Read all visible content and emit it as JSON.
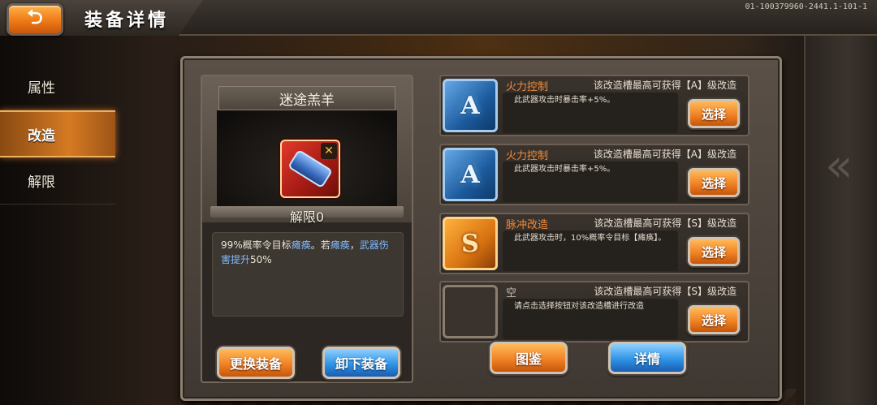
{
  "header": {
    "title": "装备详情",
    "back_icon": "back-arrow-icon",
    "version": "01-100379960-2441.1-101-1"
  },
  "nav": {
    "items": [
      {
        "label": "属性",
        "active": false
      },
      {
        "label": "改造",
        "active": true
      },
      {
        "label": "解限",
        "active": false
      }
    ]
  },
  "equipment": {
    "name": "迷途羔羊",
    "icon": "blue-cannon-weapon-icon",
    "badge_icon": "wrench-icon",
    "limit_label": "解限0",
    "description": {
      "part1": "99%概率令目标",
      "hl1": "瘫痪",
      "part2": "。若",
      "hl2": "瘫痪",
      "part3": "，",
      "hl3": "武器伤害提升",
      "part4": "50%"
    },
    "change_button": "更换装备",
    "unequip_button": "卸下装备"
  },
  "slots": [
    {
      "grade": "A",
      "name": "火力控制",
      "cap": "该改造槽最高可获得【A】级改造",
      "desc": "此武器攻击时暴击率+5%。",
      "button": "选择"
    },
    {
      "grade": "A",
      "name": "火力控制",
      "cap": "该改造槽最高可获得【A】级改造",
      "desc": "此武器攻击时暴击率+5%。",
      "button": "选择"
    },
    {
      "grade": "S",
      "name": "脉冲改造",
      "cap": "该改造槽最高可获得【S】级改造",
      "desc": "此武器攻击时，10%概率令目标【瘫痪】。",
      "button": "选择"
    },
    {
      "grade": "",
      "name": "空",
      "cap": "该改造槽最高可获得【S】级改造",
      "desc": "请点击选择按钮对该改造槽进行改造",
      "button": "选择"
    }
  ],
  "footer": {
    "atlas_button": "图鉴",
    "detail_button": "详情"
  },
  "colors": {
    "accent_orange": "#f18224",
    "accent_blue": "#2f94e6",
    "highlight_text": "#7fb9ff",
    "slot_name": "#f08a3a"
  }
}
